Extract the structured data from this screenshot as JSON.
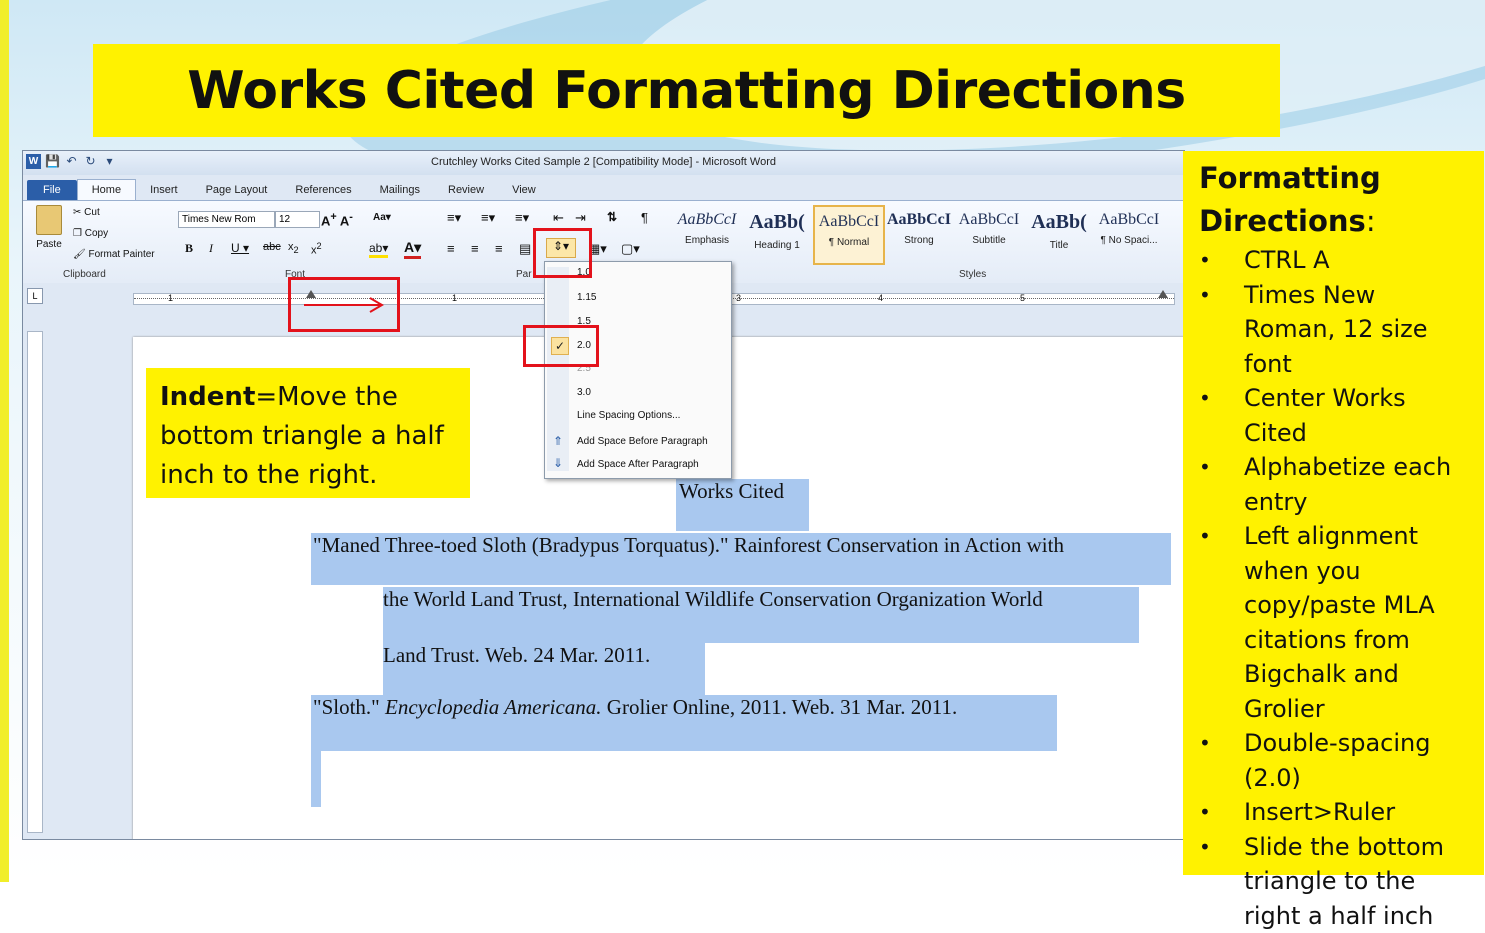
{
  "slide": {
    "title": "Works Cited Formatting Directions"
  },
  "word": {
    "window_title": "Crutchley Works Cited Sample 2 [Compatibility Mode] - Microsoft Word",
    "tabs": [
      "File",
      "Home",
      "Insert",
      "Page Layout",
      "References",
      "Mailings",
      "Review",
      "View"
    ],
    "active_tab": "Home",
    "clipboard": {
      "paste": "Paste",
      "cut": "Cut",
      "copy": "Copy",
      "format_painter": "Format Painter",
      "group_label": "Clipboard"
    },
    "font": {
      "name": "Times New Rom",
      "size": "12",
      "group_label": "Font"
    },
    "paragraph": {
      "group_label": "Par"
    },
    "styles": {
      "group_label": "Styles",
      "items": [
        {
          "sample": "AaBbCcI",
          "label": "Emphasis"
        },
        {
          "sample": "AaBb(",
          "label": "Heading 1"
        },
        {
          "sample": "AaBbCcI",
          "label": "¶ Normal"
        },
        {
          "sample": "AaBbCcI",
          "label": "Strong"
        },
        {
          "sample": "AaBbCcI",
          "label": "Subtitle"
        },
        {
          "sample": "AaBb(",
          "label": "Title"
        },
        {
          "sample": "AaBbCcI",
          "label": "¶ No Spaci..."
        }
      ]
    },
    "line_spacing_menu": {
      "items": [
        "1.0",
        "1.15",
        "1.5",
        "2.0",
        "2.5",
        "3.0"
      ],
      "checked": "2.0",
      "options": "Line Spacing Options...",
      "add_before": "Add Space Before Paragraph",
      "add_after": "Add Space After Paragraph"
    },
    "ruler_numbers": [
      "1",
      "1",
      "3",
      "4",
      "5"
    ],
    "document": {
      "heading": "Works Cited",
      "entry1_line1": "\"Maned Three-toed Sloth (Bradypus Torquatus).\" Rainforest Conservation in Action with",
      "entry1_line2": "the World Land Trust, International Wildlife Conservation Organization World",
      "entry1_line3": "Land Trust. Web. 24 Mar. 2011.",
      "entry2_start": "\"Sloth.\" ",
      "entry2_italic": "Encyclopedia Americana.",
      "entry2_end": " Grolier Online, 2011. Web. 31 Mar. 2011."
    }
  },
  "indent_note": {
    "bold": "Indent",
    "text": "=Move the bottom triangle a half inch to the right."
  },
  "directions": {
    "heading": "Formatting Directions",
    "heading_colon": ":",
    "bullet": "•",
    "items": [
      "CTRL A",
      "Times New Roman, 12 size font",
      "Center Works Cited",
      "Alphabetize each entry",
      "Left alignment when you copy/paste MLA citations from Bigchalk and Grolier",
      "Double-spacing (2.0)",
      "Insert>Ruler",
      "Slide the bottom triangle to the right a half inch"
    ]
  },
  "colors": {
    "highlight_yellow": "#fff200",
    "annotation_red": "#e3121b",
    "selection_blue": "#a9c8ef"
  }
}
